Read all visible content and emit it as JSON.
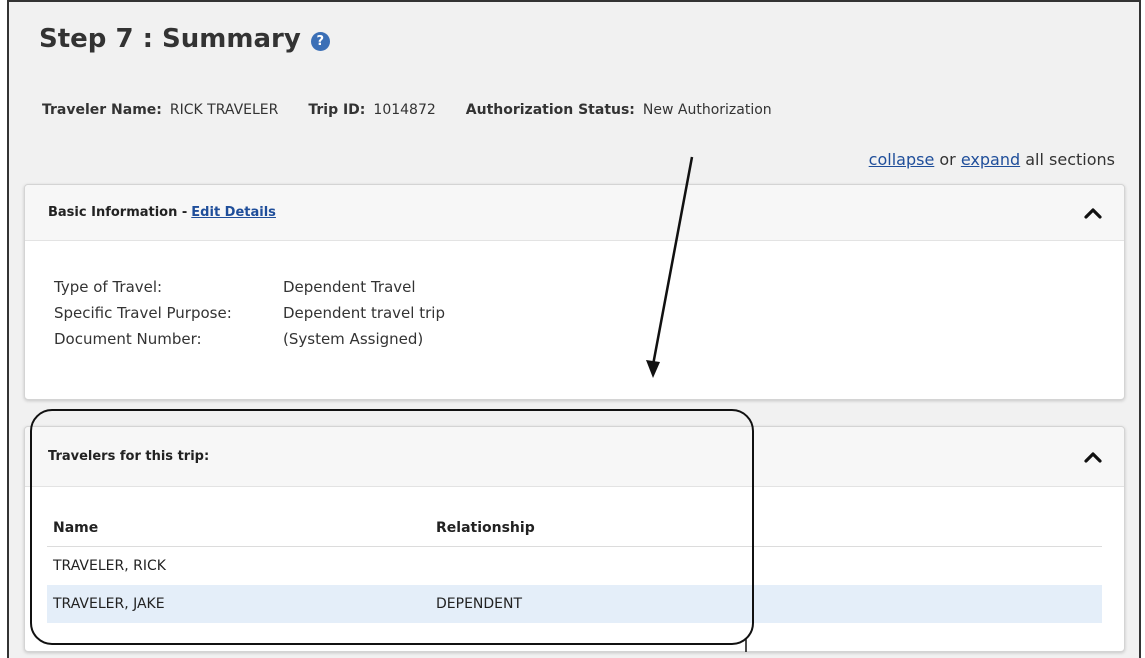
{
  "header": {
    "title": "Step 7 : Summary",
    "help_icon": "question-circle-icon"
  },
  "meta": {
    "traveler_name_label": "Traveler Name:",
    "traveler_name_value": "RICK TRAVELER",
    "trip_id_label": "Trip ID:",
    "trip_id_value": "1014872",
    "auth_status_label": "Authorization Status:",
    "auth_status_value": "New Authorization"
  },
  "toggle_all": {
    "collapse": "collapse",
    "or": "or",
    "expand": "expand",
    "suffix": "all sections"
  },
  "basic_info": {
    "heading": "Basic Information -",
    "edit_link": "Edit Details",
    "rows": [
      {
        "label": "Type of Travel:",
        "value": "Dependent Travel"
      },
      {
        "label": "Specific Travel Purpose:",
        "value": "Dependent travel trip"
      },
      {
        "label": "Document Number:",
        "value": "(System Assigned)"
      }
    ]
  },
  "travelers": {
    "heading": "Travelers for this trip:",
    "columns": [
      "Name",
      "Relationship"
    ],
    "rows": [
      {
        "name": "TRAVELER, RICK",
        "relationship": ""
      },
      {
        "name": "TRAVELER, JAKE",
        "relationship": "DEPENDENT"
      }
    ]
  },
  "colors": {
    "link": "#1f4e9a",
    "help_icon": "#3b6fb6",
    "selected_row": "#e4eef9",
    "page_bg": "#f1f1f1"
  }
}
